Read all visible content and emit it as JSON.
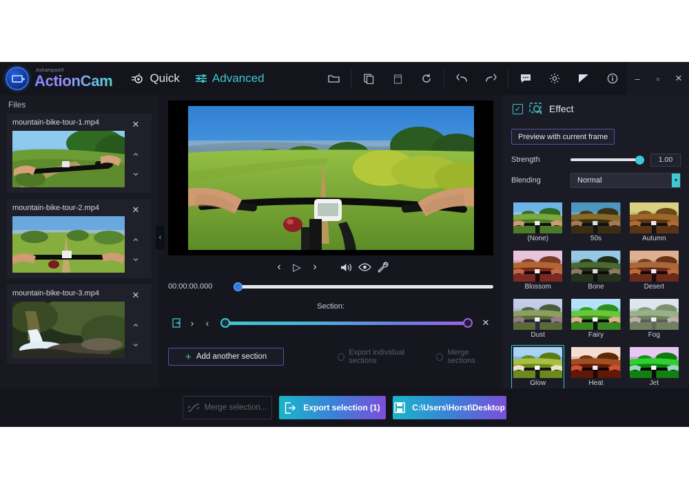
{
  "app": {
    "brand_small": "Ashampoo®",
    "brand_main": "ActionCam"
  },
  "modes": [
    {
      "label": "Quick",
      "icon": "quick-camera-icon",
      "active": false
    },
    {
      "label": "Advanced",
      "icon": "sliders-icon",
      "active": true
    }
  ],
  "toolbar": {
    "groups": [
      {
        "items": [
          {
            "name": "open-folder-icon",
            "glyph": "folder"
          }
        ]
      },
      {
        "items": [
          {
            "name": "copy-icon",
            "glyph": "copy"
          },
          {
            "name": "delete-icon",
            "glyph": "trash"
          },
          {
            "name": "reset-icon",
            "glyph": "refresh"
          }
        ]
      },
      {
        "items": [
          {
            "name": "undo-icon",
            "glyph": "undo"
          },
          {
            "name": "redo-icon",
            "glyph": "redo"
          }
        ]
      },
      {
        "items": [
          {
            "name": "feedback-icon",
            "glyph": "chat"
          },
          {
            "name": "settings-icon",
            "glyph": "gear"
          },
          {
            "name": "contrast-icon",
            "glyph": "contrast"
          },
          {
            "name": "info-icon",
            "glyph": "info"
          }
        ]
      }
    ],
    "window": [
      {
        "name": "minimize-button",
        "glyph": "–"
      },
      {
        "name": "maximize-button",
        "glyph": "▫"
      },
      {
        "name": "close-button",
        "glyph": "✕"
      }
    ]
  },
  "files": {
    "title": "Files",
    "items": [
      {
        "name": "mountain-bike-tour-1.mp4",
        "scene": "trail-trees"
      },
      {
        "name": "mountain-bike-tour-2.mp4",
        "scene": "meadow"
      },
      {
        "name": "mountain-bike-tour-3.mp4",
        "scene": "waterfall"
      }
    ],
    "close_glyph": "✕",
    "up_glyph": "⌃",
    "down_glyph": "⌄",
    "collapse_glyph": "‹"
  },
  "player": {
    "controls": [
      {
        "name": "previous-frame-button",
        "glyph": "‹"
      },
      {
        "name": "play-button",
        "glyph": "▷"
      },
      {
        "name": "next-frame-button",
        "glyph": "›"
      },
      {
        "name": "volume-button",
        "glyph": "volume"
      },
      {
        "name": "preview-eye-button",
        "glyph": "eye"
      },
      {
        "name": "tools-button",
        "glyph": "wrench"
      }
    ],
    "timecode": "00:00:00.000",
    "seek_position_pct": 0
  },
  "section": {
    "label": "Section:",
    "start_pct": 0,
    "end_pct": 100,
    "buttons": [
      {
        "name": "section-export-icon",
        "glyph": "export"
      },
      {
        "name": "section-next-icon",
        "glyph": "›"
      },
      {
        "name": "section-prev-icon",
        "glyph": "‹"
      }
    ],
    "remove_glyph": "✕",
    "add_label": "Add another section",
    "add_plus": "+",
    "options": [
      {
        "label": "Export individual sections",
        "selected": false
      },
      {
        "label": "Merge sections",
        "selected": false
      }
    ]
  },
  "effect_panel": {
    "title": "Effect",
    "enabled_check": "☑",
    "panel_icon": "effect-preview-icon",
    "preview_button": "Preview with current frame",
    "strength_label": "Strength",
    "strength_value": "1.00",
    "strength_pct": 100,
    "blending_label": "Blending",
    "blending_value": "Normal",
    "accent_color": "#3fc9d0",
    "effects": [
      {
        "label": "(None)",
        "selected": false,
        "sky": "#8fc6f0",
        "sky2": "#cfe6f8",
        "ground": "#7aa83e",
        "ground2": "#4d7a28",
        "tint": "none"
      },
      {
        "label": "50s",
        "selected": false,
        "sky": "#5fa8c8",
        "sky2": "#9fd0d8",
        "ground": "#8a6a28",
        "ground2": "#3a2e12",
        "tint": "sepia"
      },
      {
        "label": "Autumn",
        "selected": false,
        "sky": "#c8c070",
        "sky2": "#e6dc9a",
        "ground": "#a06828",
        "ground2": "#5a3414",
        "tint": "warm"
      },
      {
        "label": "Blossom",
        "selected": false,
        "sky": "#d8a8c8",
        "sky2": "#f0d0e0",
        "ground": "#b06830",
        "ground2": "#7a2a20",
        "tint": "pink"
      },
      {
        "label": "Bone",
        "selected": false,
        "sky": "#7ab4d8",
        "sky2": "#b8dcea",
        "ground": "#4a6830",
        "ground2": "#24341a",
        "tint": "cool"
      },
      {
        "label": "Desert",
        "selected": false,
        "sky": "#c89878",
        "sky2": "#e8c0a0",
        "ground": "#a86838",
        "ground2": "#6a2a1c",
        "tint": "desert"
      },
      {
        "label": "Dust",
        "selected": false,
        "sky": "#b0b8d8",
        "sky2": "#d8dcec",
        "ground": "#8aa060",
        "ground2": "#5a6a38",
        "tint": "dusty"
      },
      {
        "label": "Fairy",
        "selected": false,
        "sky": "#8fd0f0",
        "sky2": "#d8f0ff",
        "ground": "#6ac83a",
        "ground2": "#3a8a20",
        "tint": "bright"
      },
      {
        "label": "Fog",
        "selected": false,
        "sky": "#c8d4dc",
        "sky2": "#e8eef2",
        "ground": "#9ab088",
        "ground2": "#708060",
        "tint": "fog"
      },
      {
        "label": "Glow",
        "selected": true,
        "sky": "#7ab8e8",
        "sky2": "#cfe8fa",
        "ground": "#a8c040",
        "ground2": "#6a8a20",
        "tint": "glow"
      },
      {
        "label": "Heat",
        "selected": false,
        "sky": "#e8b8b0",
        "sky2": "#f8dcd0",
        "ground": "#a05020",
        "ground2": "#601808",
        "tint": "heat"
      },
      {
        "label": "Jet",
        "selected": false,
        "sky": "#d0a8e0",
        "sky2": "#e8d0f0",
        "ground": "#30d030",
        "ground2": "#108010",
        "tint": "jet"
      },
      {
        "label": "",
        "selected": false,
        "sky": "#9ab8d0",
        "sky2": "#cfe0ea",
        "ground": "#4aa030",
        "ground2": "#207018",
        "tint": "none"
      },
      {
        "label": "",
        "selected": false,
        "sky": "#f8d820",
        "sky2": "#fff080",
        "ground": "#e02000",
        "ground2": "#800800",
        "tint": "fire"
      },
      {
        "label": "",
        "selected": false,
        "sky": "#c0c0c0",
        "sky2": "#e8e8e8",
        "ground": "#888888",
        "ground2": "#4a4a4a",
        "tint": "gray"
      }
    ]
  },
  "bottom_bar": {
    "merge_label": "Merge selection...",
    "merge_icon": "link-icon",
    "export_label": "Export selection (1)",
    "export_icon": "export-icon",
    "destination_label": "C:\\Users\\Horst\\Desktop",
    "destination_icon": "save-icon"
  }
}
